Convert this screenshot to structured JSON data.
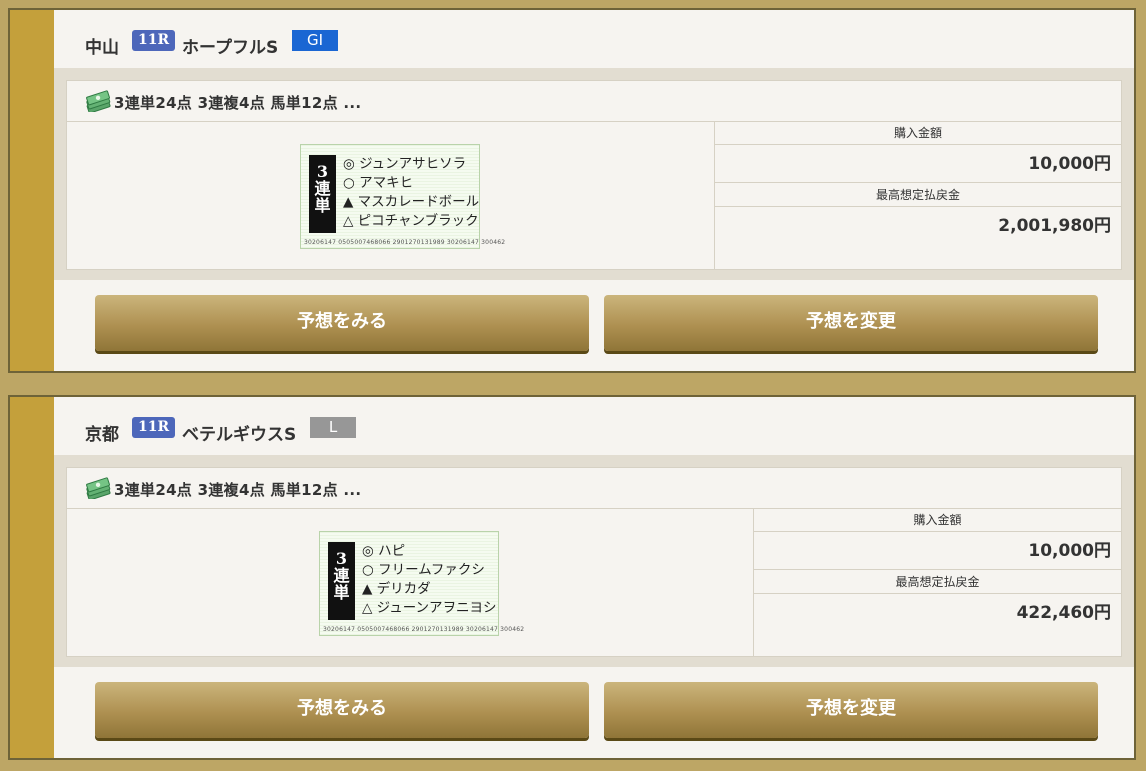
{
  "races": [
    {
      "venue": "中山",
      "race_no": "11R",
      "race_name": "ホープフルS",
      "grade": "GI",
      "grade_color": "#1a66d3",
      "bets": "3連単24点 3連複4点 馬単12点 ...",
      "ticket": {
        "type": "3\n連\n単",
        "horses": [
          "◎ ジュンアサヒソラ",
          "○ アマキヒ",
          "▲ マスカレードボール",
          "△ ピコチャンブラック"
        ],
        "code": "30206147    0505007468066 2901270131989 30206147 300462"
      },
      "purchase_label": "購入金額",
      "purchase_amount": "10,000円",
      "max_payout_label": "最高想定払戻金",
      "max_payout": "2,001,980円",
      "view_button": "予想をみる",
      "change_button": "予想を変更"
    },
    {
      "venue": "京都",
      "race_no": "11R",
      "race_name": "ベテルギウスS",
      "grade": "L",
      "grade_color": "#979797",
      "bets": "3連単24点 3連複4点 馬単12点 ...",
      "ticket": {
        "type": "3\n連\n単",
        "horses": [
          "◎ ハピ",
          "○ フリームファクシ",
          "▲ デリカダ",
          "△ ジューンアヲニヨシ"
        ],
        "code": "30206147    0505007468066 2901270131989 30206147 300462"
      },
      "purchase_label": "購入金額",
      "purchase_amount": "10,000円",
      "max_payout_label": "最高想定払戻金",
      "max_payout": "422,460円",
      "view_button": "予想をみる",
      "change_button": "予想を変更"
    }
  ]
}
